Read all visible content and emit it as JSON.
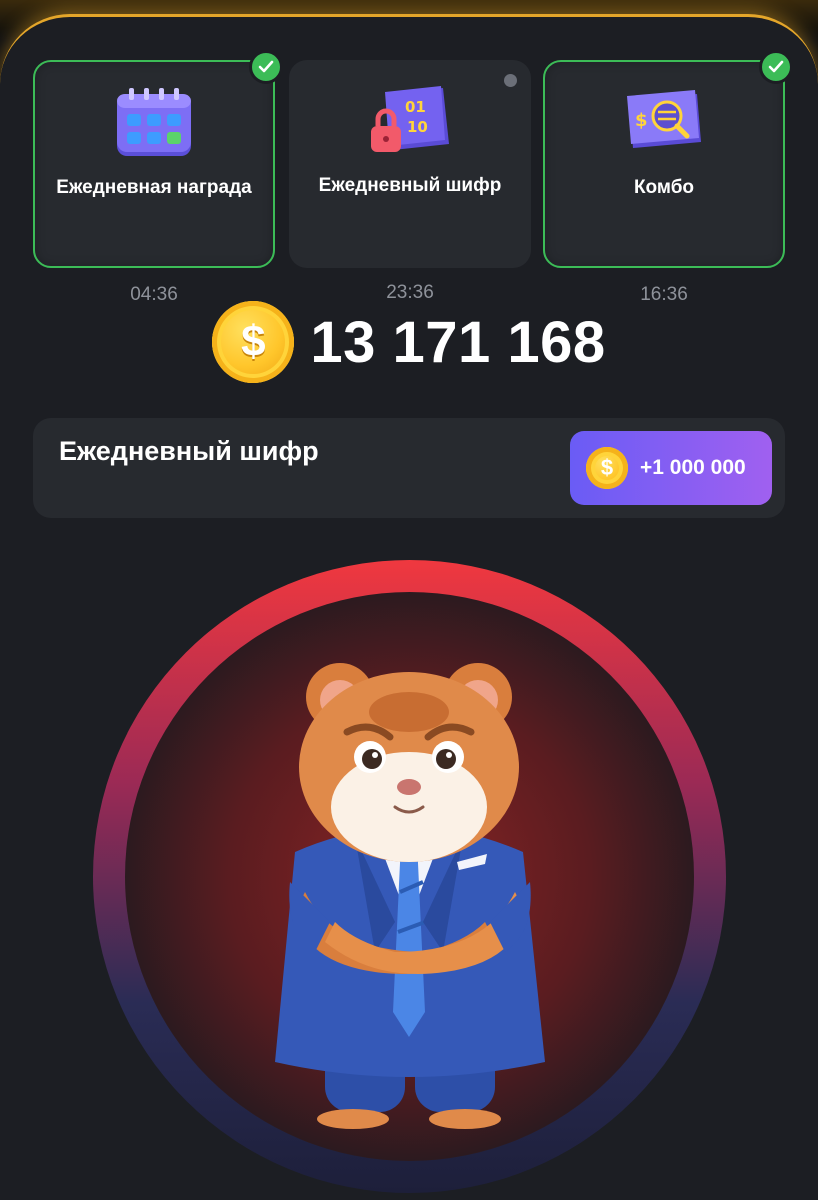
{
  "daily_cards": [
    {
      "title": "Ежедневная награда",
      "time": "04:36",
      "completed": true,
      "icon": "calendar-icon"
    },
    {
      "title": "Ежедневный шифр",
      "time": "23:36",
      "completed": false,
      "icon": "cipher-lock-icon"
    },
    {
      "title": "Комбо",
      "time": "16:36",
      "completed": true,
      "icon": "combo-card-icon"
    }
  ],
  "balance": {
    "amount": "13 171 168",
    "icon": "dollar-coin-icon"
  },
  "cipher": {
    "label": "Ежедневный шифр",
    "reward": "+1 000 000"
  },
  "colors": {
    "accent_green": "#3cbc57",
    "gold": "#ffc62b",
    "purple_start": "#6a5cf5",
    "purple_end": "#a060f0",
    "ring_red": "#f0383f"
  }
}
